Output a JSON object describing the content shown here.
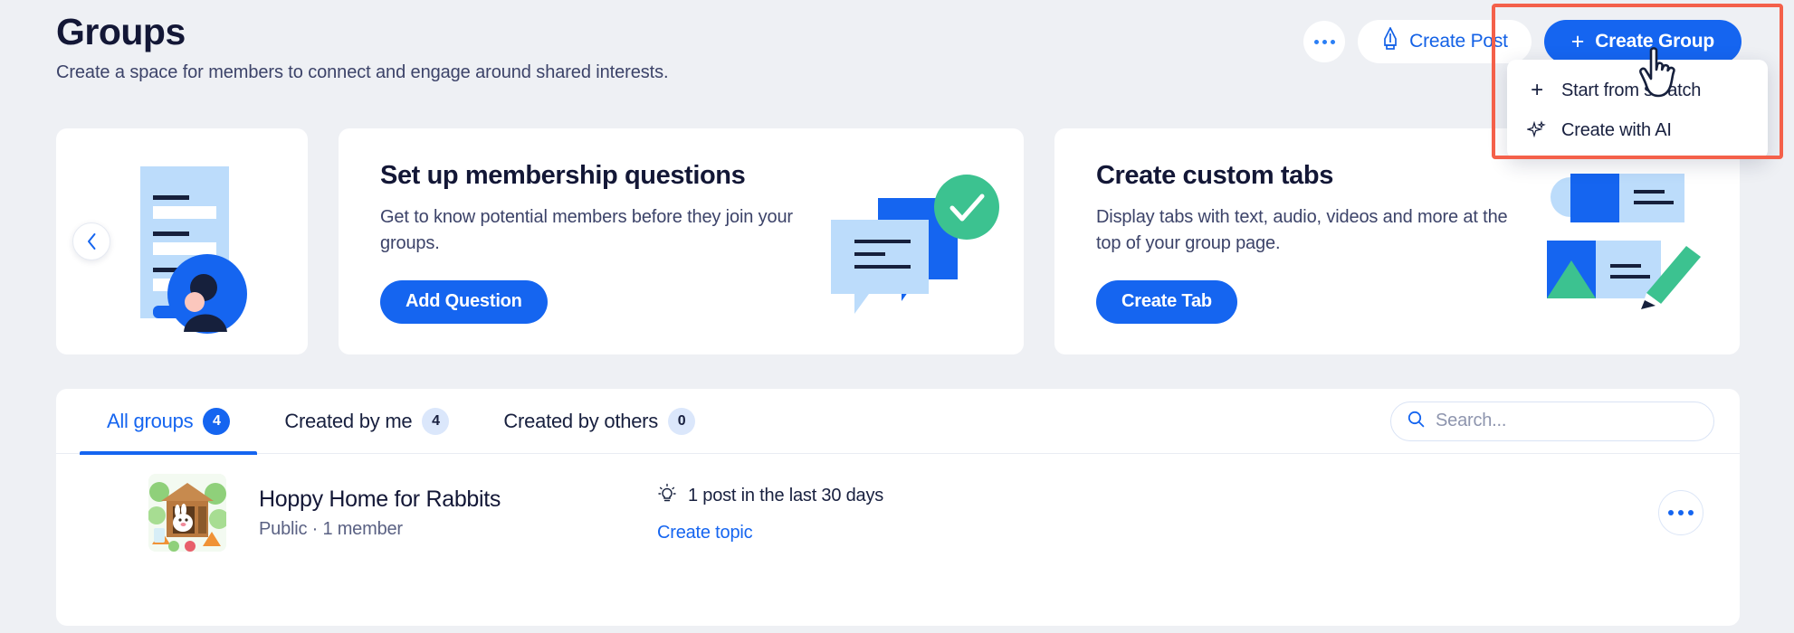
{
  "header": {
    "title": "Groups",
    "subtitle": "Create a space for members to connect and engage around shared interests.",
    "more_icon": "ellipsis-icon",
    "create_post_label": "Create Post",
    "create_post_icon": "pen-nib-icon",
    "create_group_label": "Create Group",
    "create_group_icon": "plus-icon"
  },
  "dropdown": {
    "items": [
      {
        "label": "Start from scratch",
        "icon": "plus-icon"
      },
      {
        "label": "Create with AI",
        "icon": "sparkle-icon"
      }
    ]
  },
  "cards": {
    "prev_arrow_icon": "chevron-left-icon",
    "membership": {
      "title": "Set up membership questions",
      "body": "Get to know potential members before they join your groups.",
      "cta": "Add Question",
      "illustration": "chat-bubbles-check-illustration"
    },
    "tabs_card": {
      "title": "Create custom tabs",
      "body": "Display tabs with text, audio, videos and more at the top of your group page.",
      "cta": "Create Tab",
      "illustration": "media-cards-pencil-illustration"
    },
    "left_illustration": "form-person-illustration"
  },
  "panel": {
    "tabs": [
      {
        "label": "All groups",
        "count": "4",
        "active": true
      },
      {
        "label": "Created by me",
        "count": "4",
        "active": false
      },
      {
        "label": "Created by others",
        "count": "0",
        "active": false
      }
    ],
    "search": {
      "placeholder": "Search...",
      "value": "",
      "icon": "search-icon"
    },
    "groups": [
      {
        "name": "Hoppy Home for Rabbits",
        "meta": "Public · 1 member",
        "stat": "1 post in the last 30 days",
        "stat_icon": "lightbulb-icon",
        "link": "Create topic",
        "more_icon": "ellipsis-icon",
        "thumb": "rabbit-hutch-thumbnail"
      }
    ]
  },
  "colors": {
    "accent": "#1565f0",
    "accent_text": "#1361e6",
    "highlight": "#f4604a",
    "green": "#3cc290",
    "page_bg": "#eef0f4",
    "heading": "#131736"
  }
}
